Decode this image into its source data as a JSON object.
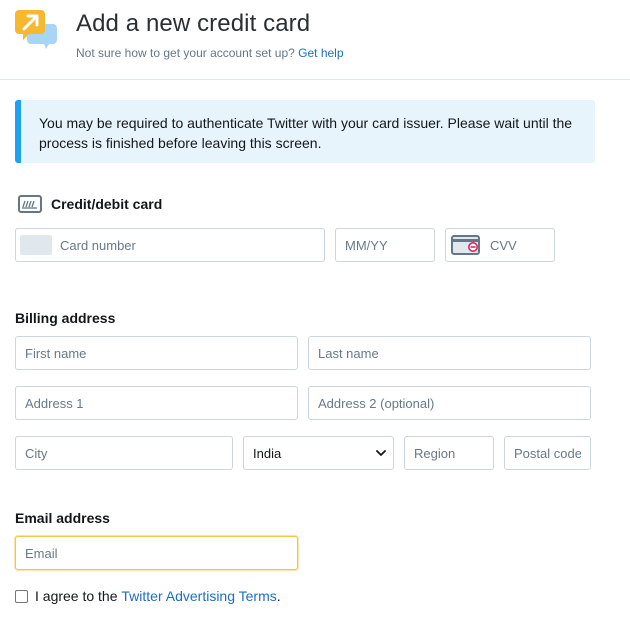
{
  "header": {
    "title": "Add a new credit card",
    "help_text": "Not sure how to get your account set up?",
    "help_link": "Get help",
    "logo_icon": "twitter-ads-icon"
  },
  "notice": {
    "text": "You may be required to authenticate Twitter with your card issuer. Please wait until the process is finished before leaving this screen."
  },
  "card_section": {
    "heading": "Credit/debit card",
    "icon": "credit-card-icon",
    "card_number_placeholder": "Card number",
    "expiry_placeholder": "MM/YY",
    "cvv_placeholder": "CVV"
  },
  "billing": {
    "heading": "Billing address",
    "first_name_placeholder": "First name",
    "last_name_placeholder": "Last name",
    "address1_placeholder": "Address 1",
    "address2_placeholder": "Address 2 (optional)",
    "city_placeholder": "City",
    "country_selected": "India",
    "region_placeholder": "Region",
    "postal_placeholder": "Postal code"
  },
  "email_section": {
    "heading": "Email address",
    "email_placeholder": "Email"
  },
  "agree": {
    "text_before": "I agree to the",
    "link": "Twitter Advertising Terms",
    "text_after": "."
  },
  "colors": {
    "link": "#1b6fc4",
    "notice_bg": "#e8f4fc",
    "notice_accent": "#1da1f2",
    "focus_border": "#f7c644",
    "logo_yellow": "#f5b82e",
    "logo_blue": "#a8d4f5"
  }
}
